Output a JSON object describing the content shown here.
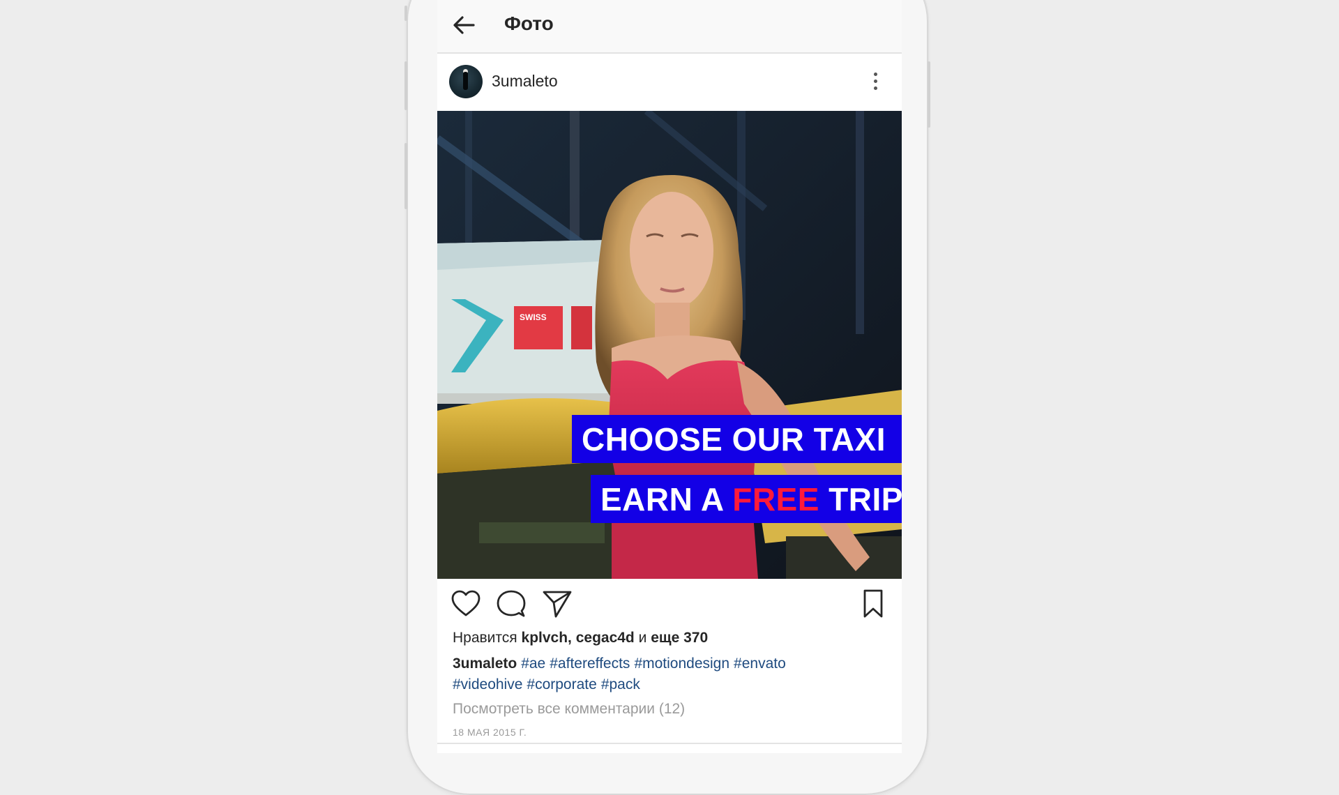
{
  "topbar": {
    "title": "Фото"
  },
  "post": {
    "username": "3umaleto",
    "overlay": {
      "line1": "CHOOSE OUR TAXI",
      "line2_prefix": "EARN A ",
      "line2_highlight": "FREE",
      "line2_suffix": " TRIP"
    },
    "sign_text": "SWISS"
  },
  "likes": {
    "prefix": "Нравится",
    "users": "kplvch, cegac4d",
    "conj": "и",
    "more": "еще 370"
  },
  "caption": {
    "username": "3umaleto",
    "tags": [
      "#ae",
      "#aftereffects",
      "#motiondesign",
      "#envato",
      "#videohive",
      "#corporate",
      "#pack"
    ]
  },
  "comments_link": "Посмотреть все комментарии (12)",
  "date": "18 МАЯ 2015 Г.",
  "icons": {
    "back": "arrow-left-icon",
    "more": "more-vertical-icon",
    "like": "heart-icon",
    "comment": "comment-bubble-icon",
    "share": "send-paper-plane-icon",
    "save": "bookmark-icon"
  },
  "colors": {
    "overlay_box": "#1300e6",
    "overlay_highlight": "#ff1a3a",
    "hashtag": "#1e4a7f",
    "muted": "#9a9a9a"
  }
}
